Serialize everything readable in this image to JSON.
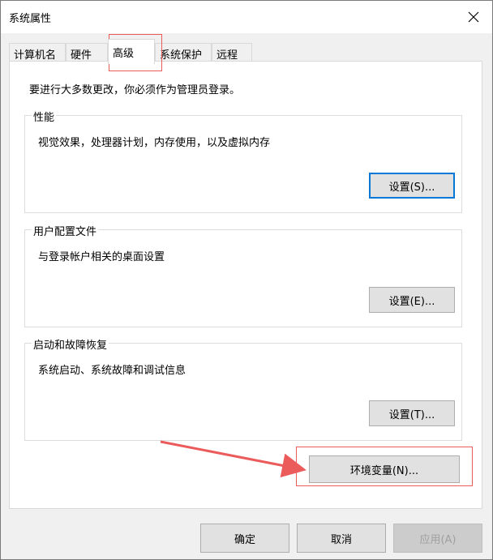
{
  "window": {
    "title": "系统属性",
    "close_icon": "close-icon"
  },
  "tabs": [
    {
      "label": "计算机名",
      "active": false
    },
    {
      "label": "硬件",
      "active": false
    },
    {
      "label": "高级",
      "active": true
    },
    {
      "label": "系统保护",
      "active": false
    },
    {
      "label": "远程",
      "active": false
    }
  ],
  "advanced": {
    "admin_note": "要进行大多数更改，你必须作为管理员登录。",
    "performance": {
      "title": "性能",
      "description": "视觉效果，处理器计划，内存使用，以及虚拟内存",
      "button": "设置(S)..."
    },
    "user_profiles": {
      "title": "用户配置文件",
      "description": "与登录帐户相关的桌面设置",
      "button": "设置(E)..."
    },
    "startup_recovery": {
      "title": "启动和故障恢复",
      "description": "系统启动、系统故障和调试信息",
      "button": "设置(T)..."
    },
    "env_button": "环境变量(N)..."
  },
  "footer": {
    "ok": "确定",
    "cancel": "取消",
    "apply": "应用(A)"
  },
  "annotation": {
    "color": "#ec5b5b"
  }
}
